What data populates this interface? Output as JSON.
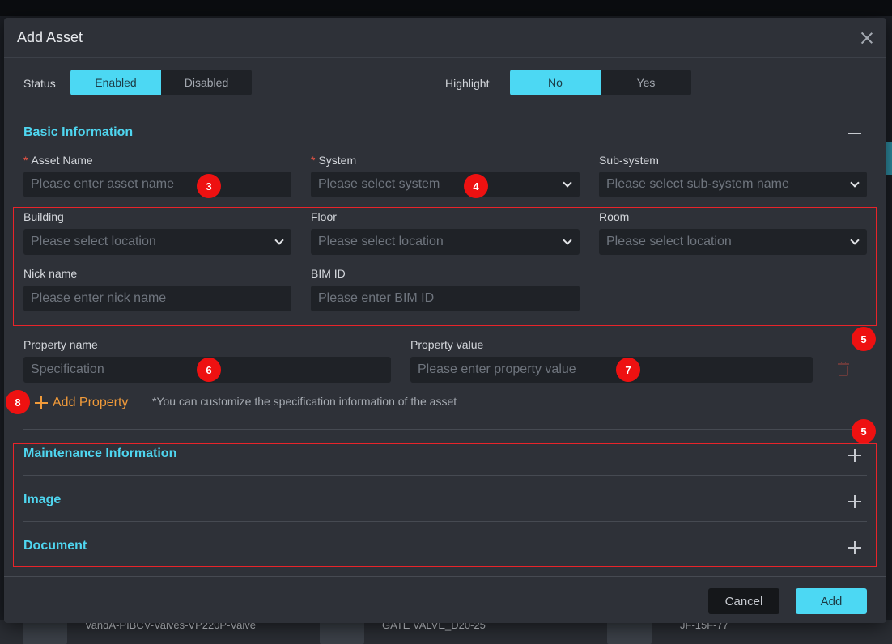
{
  "background": {
    "items": [
      "VandA-PIBCV-Valves-VP220P-Valve",
      "GATE VALVE_D20-25",
      "JF-15F-77"
    ]
  },
  "modal": {
    "title": "Add Asset",
    "status": {
      "label": "Status",
      "options": [
        "Enabled",
        "Disabled"
      ],
      "selected": "Enabled"
    },
    "highlight": {
      "label": "Highlight",
      "options": [
        "No",
        "Yes"
      ],
      "selected": "No"
    },
    "basic": {
      "title": "Basic Information",
      "asset_name": {
        "label": "Asset Name",
        "placeholder": "Please enter asset name"
      },
      "system": {
        "label": "System",
        "placeholder": "Please select system"
      },
      "subsystem": {
        "label": "Sub-system",
        "placeholder": "Please select sub-system name"
      },
      "building": {
        "label": "Building",
        "placeholder": "Please select location"
      },
      "floor": {
        "label": "Floor",
        "placeholder": "Please select location"
      },
      "room": {
        "label": "Room",
        "placeholder": "Please select location"
      },
      "nickname": {
        "label": "Nick name",
        "placeholder": "Please enter nick name"
      },
      "bim": {
        "label": "BIM ID",
        "placeholder": "Please enter BIM ID"
      },
      "property_name": {
        "label": "Property name",
        "placeholder": "Specification"
      },
      "property_value": {
        "label": "Property value",
        "placeholder": "Please enter property value"
      },
      "add_property": "Add Property",
      "hint": "*You can customize the specification information of the asset"
    },
    "sections": [
      "Maintenance Information",
      "Image",
      "Document"
    ],
    "buttons": {
      "cancel": "Cancel",
      "add": "Add"
    },
    "badges": {
      "b3": "3",
      "b4": "4",
      "b5a": "5",
      "b5b": "5",
      "b6": "6",
      "b7": "7",
      "b8": "8"
    },
    "accent_color": "#4cd8f3",
    "annotation_color": "#ee1111"
  }
}
